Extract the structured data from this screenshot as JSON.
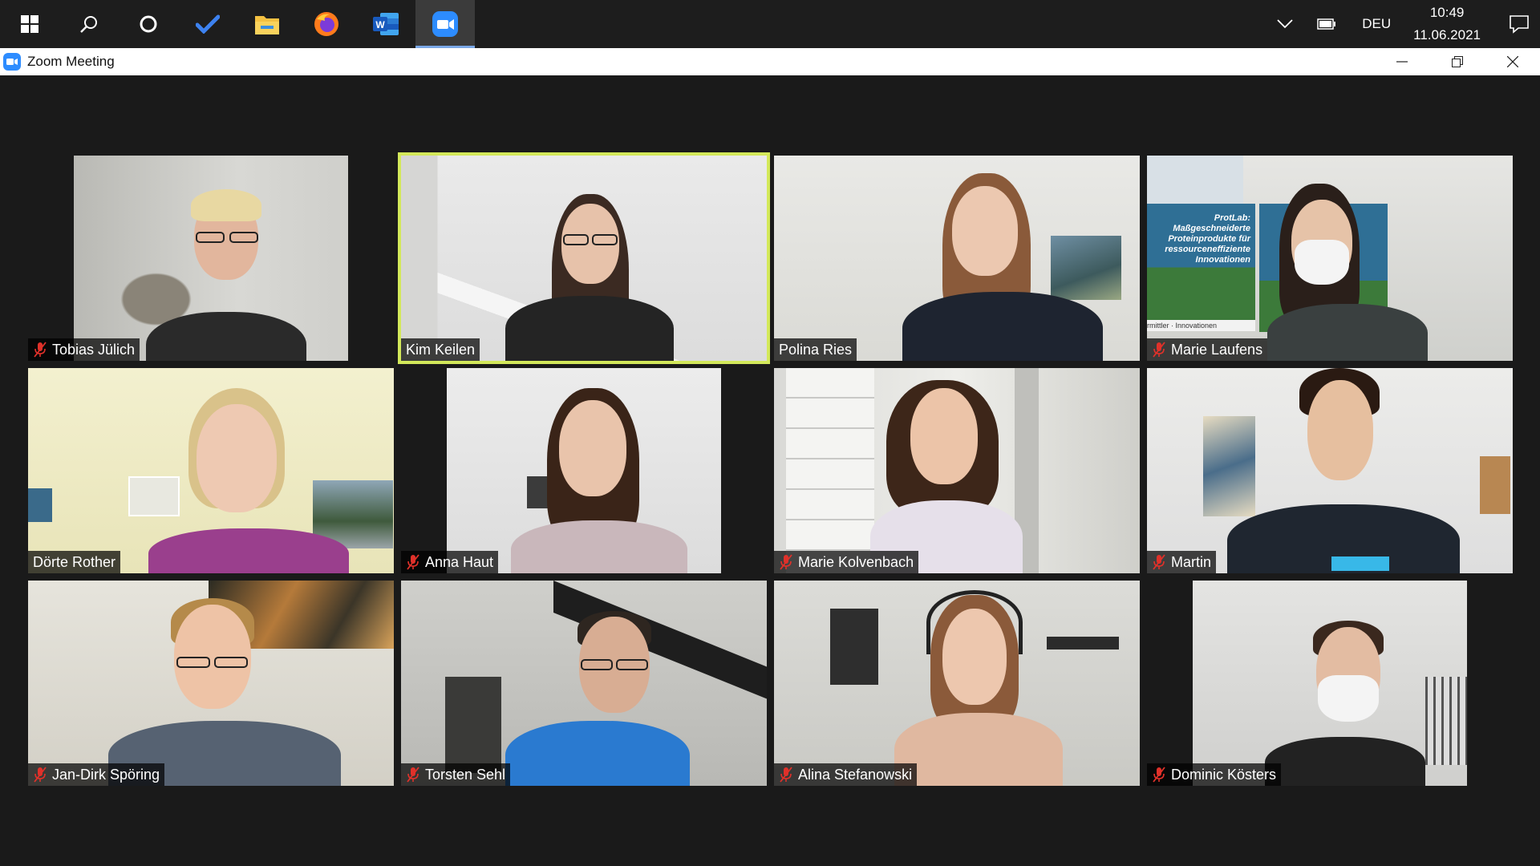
{
  "taskbar": {
    "apps": [
      {
        "name": "start",
        "icon": "windows-logo-icon"
      },
      {
        "name": "search",
        "icon": "search-icon"
      },
      {
        "name": "cortana",
        "icon": "cortana-circle-icon"
      },
      {
        "name": "todo",
        "icon": "checkmark-icon"
      },
      {
        "name": "explorer",
        "icon": "folder-icon"
      },
      {
        "name": "firefox",
        "icon": "firefox-icon"
      },
      {
        "name": "word",
        "icon": "word-icon"
      },
      {
        "name": "zoom",
        "icon": "zoom-icon",
        "active": true
      }
    ],
    "language": "DEU",
    "time": "10:49",
    "date": "11.06.2021"
  },
  "window": {
    "title": "Zoom Meeting",
    "controls": [
      "minimize",
      "restore",
      "close"
    ]
  },
  "colors": {
    "speaker_border": "#d3e85a",
    "mute_red": "#e0312a",
    "zoom_blue": "#2d8cff"
  },
  "participants": [
    {
      "name": "Tobias Jülich",
      "muted": true
    },
    {
      "name": "Kim Keilen",
      "muted": false,
      "speaking": true
    },
    {
      "name": "Polina Ries",
      "muted": false
    },
    {
      "name": "Marie Laufens",
      "muted": true
    },
    {
      "name": "Dörte Rother",
      "muted": false
    },
    {
      "name": "Anna Haut",
      "muted": true
    },
    {
      "name": "Marie Kolvenbach",
      "muted": true
    },
    {
      "name": "Martin",
      "muted": true
    },
    {
      "name": "Jan-Dirk Spöring",
      "muted": true
    },
    {
      "name": "Torsten Sehl",
      "muted": true
    },
    {
      "name": "Alina Stefanowski",
      "muted": true
    },
    {
      "name": "Dominic Kösters",
      "muted": true
    }
  ],
  "banner_text": [
    "ProtLab:",
    "Maßgeschneiderte",
    "Proteinprodukte für",
    "ressourceneffiziente",
    "Innovationen",
    "rmittler · Innovationen"
  ]
}
